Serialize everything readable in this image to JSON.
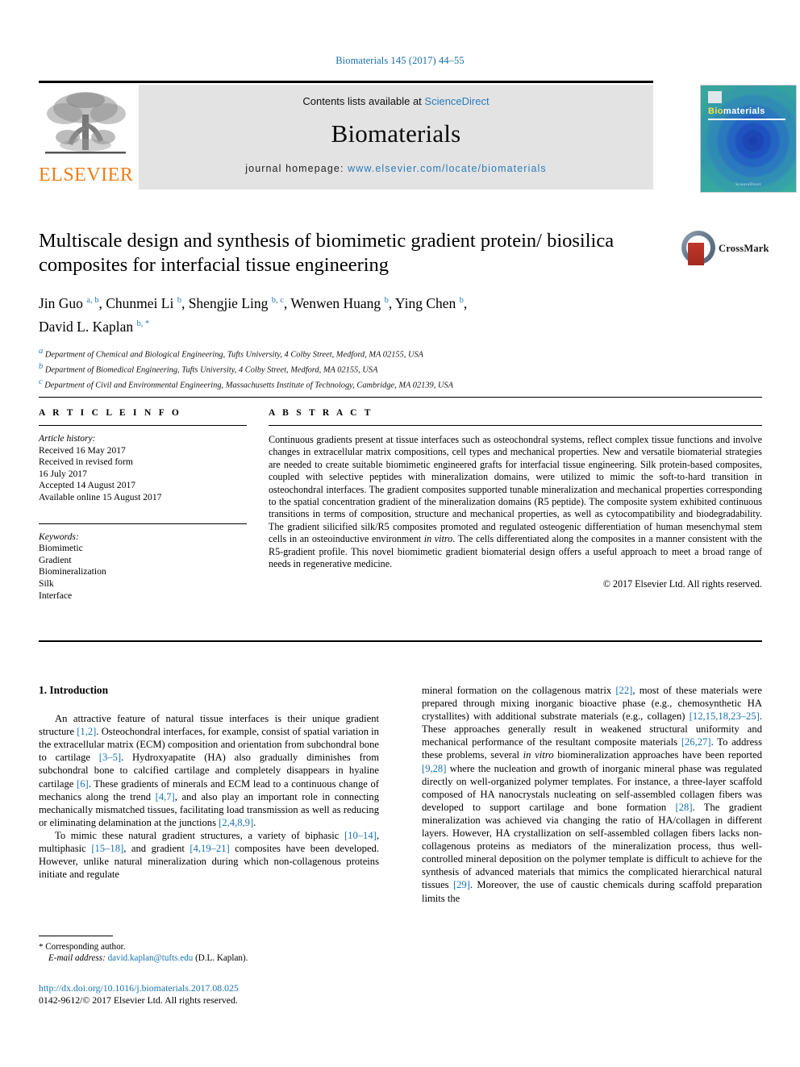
{
  "running_head": "Biomaterials 145 (2017) 44–55",
  "masthead": {
    "contents_prefix": "Contents lists available at ",
    "sciencedirect": "ScienceDirect",
    "journal_title": "Biomaterials",
    "homepage_prefix": "journal homepage: ",
    "homepage_url": "www.elsevier.com/locate/biomaterials",
    "publisher_logo_text": "ELSEVIER",
    "cover": {
      "title_part1": "Bio",
      "title_part2": "materials",
      "footer": "ScienceDirect"
    }
  },
  "article": {
    "title": "Multiscale design and synthesis of biomimetic gradient protein/ biosilica composites for interfacial tissue engineering",
    "authors": [
      {
        "name": "Jin Guo",
        "marks": "a, b"
      },
      {
        "name": "Chunmei Li",
        "marks": "b"
      },
      {
        "name": "Shengjie Ling",
        "marks": "b, c"
      },
      {
        "name": "Wenwen Huang",
        "marks": "b"
      },
      {
        "name": "Ying Chen",
        "marks": "b"
      },
      {
        "name": "David L. Kaplan",
        "marks": "b, *"
      }
    ],
    "affiliations": [
      {
        "mark": "a",
        "text": "Department of Chemical and Biological Engineering, Tufts University, 4 Colby Street, Medford, MA 02155, USA"
      },
      {
        "mark": "b",
        "text": "Department of Biomedical Engineering, Tufts University, 4 Colby Street, Medford, MA 02155, USA"
      },
      {
        "mark": "c",
        "text": "Department of Civil and Environmental Engineering, Massachusetts Institute of Technology, Cambridge, MA 02139, USA"
      }
    ],
    "crossmark_label": "CrossMark"
  },
  "article_info": {
    "heading": "A R T I C L E  I N F O",
    "history_label": "Article history:",
    "history": [
      "Received 16 May 2017",
      "Received in revised form",
      "16 July 2017",
      "Accepted 14 August 2017",
      "Available online 15 August 2017"
    ],
    "keywords_label": "Keywords:",
    "keywords": [
      "Biomimetic",
      "Gradient",
      "Biomineralization",
      "Silk",
      "Interface"
    ]
  },
  "abstract": {
    "heading": "A B S T R A C T",
    "text_before_italic": "Continuous gradients present at tissue interfaces such as osteochondral systems, reflect complex tissue functions and involve changes in extracellular matrix compositions, cell types and mechanical properties. New and versatile biomaterial strategies are needed to create suitable biomimetic engineered grafts for interfacial tissue engineering. Silk protein-based composites, coupled with selective peptides with mineralization domains, were utilized to mimic the soft-to-hard transition in osteochondral interfaces. The gradient composites supported tunable mineralization and mechanical properties corresponding to the spatial concentration gradient of the mineralization domains (R5 peptide). The composite system exhibited continuous transitions in terms of composition, structure and mechanical properties, as well as cytocompatibility and biodegradability. The gradient silicified silk/R5 composites promoted and regulated osteogenic differentiation of human mesenchymal stem cells in an osteoinductive environment ",
    "italic_phrase": "in vitro",
    "text_after_italic": ". The cells differentiated along the composites in a manner consistent with the R5-gradient profile. This novel biomimetic gradient biomaterial design offers a useful approach to meet a broad range of needs in regenerative medicine.",
    "copyright": "© 2017 Elsevier Ltd. All rights reserved."
  },
  "introduction": {
    "heading": "1.  Introduction",
    "left_paragraph_1": {
      "p1": "An attractive feature of natural tissue interfaces is their unique gradient structure ",
      "c1": "[1,2]",
      "p2": ". Osteochondral interfaces, for example, consist of spatial variation in the extracellular matrix (ECM) composition and orientation from subchondral bone to cartilage ",
      "c2": "[3–5]",
      "p3": ". Hydroxyapatite (HA) also gradually diminishes from subchondral bone to calcified cartilage and completely disappears in hyaline cartilage ",
      "c3": "[6]",
      "p4": ". These gradients of minerals and ECM lead to a continuous change of mechanics along the trend ",
      "c4": "[4,7]",
      "p5": ", and also play an important role in connecting mechanically mismatched tissues, facilitating load transmission as well as reducing or eliminating delamination at the junctions ",
      "c5": "[2,4,8,9]",
      "p6": "."
    },
    "left_paragraph_2": {
      "p1": "To mimic these natural gradient structures, a variety of biphasic ",
      "c1": "[10–14]",
      "p2": ", multiphasic ",
      "c2": "[15–18]",
      "p3": ", and gradient ",
      "c3": "[4,19–21]",
      "p4": " composites have been developed. However, unlike natural mineralization during which non-collagenous proteins initiate and regulate"
    },
    "right_paragraph": {
      "p1": "mineral formation on the collagenous matrix ",
      "c1": "[22]",
      "p2": ", most of these materials were prepared through mixing inorganic bioactive phase (e.g., chemosynthetic HA crystallites) with additional substrate materials (e.g., collagen) ",
      "c2": "[12,15,18,23–25]",
      "p3": ". These approaches generally result in weakened structural uniformity and mechanical performance of the resultant composite materials ",
      "c3": "[26,27]",
      "p4": ". To address these problems, several ",
      "i1": "in vitro",
      "p5": " biomineralization approaches have been reported ",
      "c4": "[9,28]",
      "p6": " where the nucleation and growth of inorganic mineral phase was regulated directly on well-organized polymer templates. For instance, a three-layer scaffold composed of HA nanocrystals nucleating on self-assembled collagen fibers was developed to support cartilage and bone formation ",
      "c5": "[28]",
      "p7": ". The gradient mineralization was achieved via changing the ratio of HA/collagen in different layers. However, HA crystallization on self-assembled collagen fibers lacks non-collagenous proteins as mediators of the mineralization process, thus well-controlled mineral deposition on the polymer template is difficult to achieve for the synthesis of advanced materials that mimics the complicated hierarchical natural tissues ",
      "c6": "[29]",
      "p8": ". Moreover, the use of caustic chemicals during scaffold preparation limits the"
    }
  },
  "footnote": {
    "star": "*",
    "corresponding": " Corresponding author.",
    "email_label": "E-mail address:",
    "email": "david.kaplan@tufts.edu",
    "email_suffix": " (D.L. Kaplan)."
  },
  "footer": {
    "doi": "http://dx.doi.org/10.1016/j.biomaterials.2017.08.025",
    "issn_line": "0142-9612/© 2017 Elsevier Ltd. All rights reserved."
  },
  "colors": {
    "link_blue": "#1a72b0",
    "elsevier_orange": "#ef7d18",
    "masthead_grey": "#e3e3e3"
  }
}
